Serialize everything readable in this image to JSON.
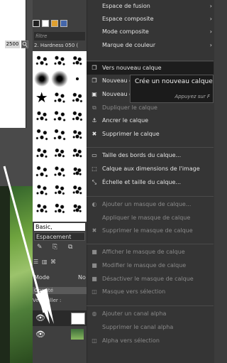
{
  "toolbar": {
    "zoom_value": "2500"
  },
  "brushes": {
    "filter_placeholder": "filtre",
    "selected_brush": "2. Hardness 050 (",
    "tag_label": "Basic,",
    "mode": "Espacement"
  },
  "layers": {
    "mode_label": "Mode",
    "mode_value": "No",
    "opacity_label": "Opacité",
    "lock_label": "Verrouiller :"
  },
  "menu": {
    "items": [
      {
        "label": "Espace de fusion",
        "icon": "",
        "submenu": true,
        "disabled": false
      },
      {
        "label": "Espace composite",
        "icon": "",
        "submenu": true,
        "disabled": false
      },
      {
        "label": "Mode composite",
        "icon": "",
        "submenu": true,
        "disabled": false
      },
      {
        "label": "Marque de couleur",
        "icon": "",
        "submenu": true,
        "disabled": false
      },
      {
        "label": "Vers nouveau calque",
        "icon": "new-layer-icon",
        "submenu": false,
        "disabled": false,
        "highlighted": true
      },
      {
        "label": "Nouveau c",
        "icon": "new-layer-icon",
        "submenu": false,
        "disabled": false
      },
      {
        "label": "Nouveau g",
        "icon": "new-group-icon",
        "submenu": false,
        "disabled": false
      },
      {
        "label": "Dupliquer le calque",
        "icon": "duplicate-icon",
        "submenu": false,
        "disabled": true
      },
      {
        "label": "Ancrer le calque",
        "icon": "anchor-icon",
        "submenu": false,
        "disabled": false
      },
      {
        "label": "Supprimer le calque",
        "icon": "delete-icon",
        "submenu": false,
        "disabled": false
      },
      {
        "label": "Taille des bords du calque...",
        "icon": "layer-boundary-icon",
        "submenu": false,
        "disabled": false
      },
      {
        "label": "Calque aux dimensions de l'image",
        "icon": "layer-to-image-icon",
        "submenu": false,
        "disabled": false
      },
      {
        "label": "Échelle et taille du calque...",
        "icon": "scale-layer-icon",
        "submenu": false,
        "disabled": false
      },
      {
        "label": "Ajouter un masque de calque...",
        "icon": "add-mask-icon",
        "submenu": false,
        "disabled": true
      },
      {
        "label": "Appliquer le masque de calque",
        "icon": "",
        "submenu": false,
        "disabled": true
      },
      {
        "label": "Supprimer le masque de calque",
        "icon": "delete-mask-icon",
        "submenu": false,
        "disabled": true
      },
      {
        "label": "Afficher le masque de calque",
        "icon": "checkbox-icon",
        "submenu": false,
        "disabled": true
      },
      {
        "label": "Modifier le masque de calque",
        "icon": "checkbox-icon",
        "submenu": false,
        "disabled": true
      },
      {
        "label": "Désactiver le masque de calque",
        "icon": "checkbox-icon",
        "submenu": false,
        "disabled": true
      },
      {
        "label": "Masque vers sélection",
        "icon": "mask-to-selection-icon",
        "submenu": false,
        "disabled": true
      },
      {
        "label": "Ajouter un canal alpha",
        "icon": "alpha-icon",
        "submenu": false,
        "disabled": true
      },
      {
        "label": "Supprimer le canal alpha",
        "icon": "",
        "submenu": false,
        "disabled": true
      },
      {
        "label": "Alpha vers sélection",
        "icon": "alpha-to-selection-icon",
        "submenu": false,
        "disabled": true
      }
    ]
  },
  "tooltip": {
    "title": "Crée un nouveau calque",
    "hint": "Appuyez sur F"
  },
  "colors": {
    "menu_bg": "#353535",
    "highlight_bg": "#1d1d1d",
    "disabled_text": "#8a8a8a"
  }
}
